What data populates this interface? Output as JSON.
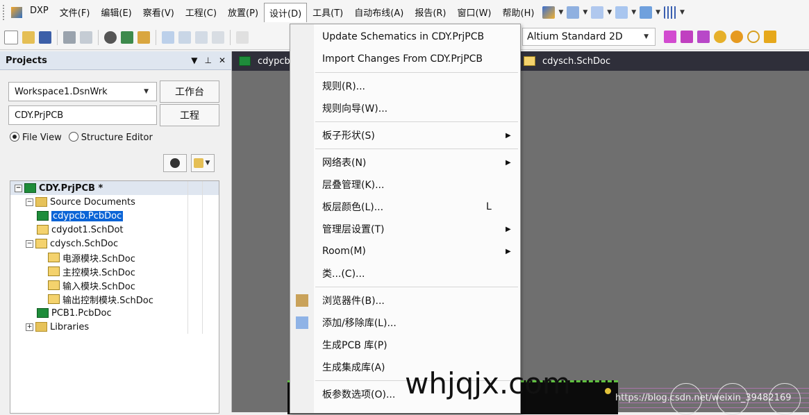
{
  "menubar": {
    "items": [
      "DXP",
      "文件(F)",
      "编辑(E)",
      "察看(V)",
      "工程(C)",
      "放置(P)",
      "设计(D)",
      "工具(T)",
      "自动布线(A)",
      "报告(R)",
      "窗口(W)",
      "帮助(H)"
    ],
    "active_index": 6
  },
  "toolbar": {
    "view_mode": "Altium Standard 2D"
  },
  "projects": {
    "title": "Projects",
    "workspace_value": "Workspace1.DsnWrk",
    "workspace_button": "工作台",
    "project_value": "CDY.PrjPCB",
    "project_button": "工程",
    "view_file": "File View",
    "view_structure": "Structure Editor",
    "tree": [
      {
        "label": "CDY.PrjPCB *",
        "type": "pcb",
        "level": 0,
        "expander": "−",
        "root": true
      },
      {
        "label": "Source Documents",
        "type": "folder",
        "level": 1,
        "expander": "−"
      },
      {
        "label": "cdypcb.PcbDoc",
        "type": "pcb",
        "level": 2,
        "selected": true
      },
      {
        "label": "cdydot1.SchDot",
        "type": "sch",
        "level": 2
      },
      {
        "label": "cdysch.SchDoc",
        "type": "sch",
        "level": 1,
        "expander": "−"
      },
      {
        "label": "电源模块.SchDoc",
        "type": "sch",
        "level": 3
      },
      {
        "label": "主控模块.SchDoc",
        "type": "sch",
        "level": 3
      },
      {
        "label": "输入模块.SchDoc",
        "type": "sch",
        "level": 3
      },
      {
        "label": "输出控制模块.SchDoc",
        "type": "sch",
        "level": 3
      },
      {
        "label": "PCB1.PcbDoc",
        "type": "pcb",
        "level": 2
      },
      {
        "label": "Libraries",
        "type": "folder",
        "level": 1,
        "expander": "+"
      }
    ]
  },
  "doc_tabs": [
    "cdypcb.",
    "cdysch.SchDoc"
  ],
  "design_menu": [
    {
      "label": "Update Schematics in CDY.PrjPCB"
    },
    {
      "label": "Import Changes From CDY.PrjPCB",
      "sep_after": true
    },
    {
      "label": "规则(R)..."
    },
    {
      "label": "规则向导(W)...",
      "sep_after": true
    },
    {
      "label": "板子形状(S)",
      "submenu": true,
      "sep_after": true
    },
    {
      "label": "网络表(N)",
      "submenu": true
    },
    {
      "label": "层叠管理(K)..."
    },
    {
      "label": "板层颜色(L)...",
      "shortcut": "L"
    },
    {
      "label": "管理层设置(T)",
      "submenu": true
    },
    {
      "label": "Room(M)",
      "submenu": true
    },
    {
      "label": "类...(C)...",
      "sep_after": true
    },
    {
      "label": "浏览器件(B)...",
      "icon": "browse-components-icon"
    },
    {
      "label": "添加/移除库(L)...",
      "icon": "library-book-icon"
    },
    {
      "label": "生成PCB 库(P)"
    },
    {
      "label": "生成集成库(A)",
      "sep_after": true
    },
    {
      "label": "板参数选项(O)..."
    }
  ],
  "watermark": "https://blog.csdn.net/weixin_39482169",
  "overlay_watermark": "whjqjx.com"
}
